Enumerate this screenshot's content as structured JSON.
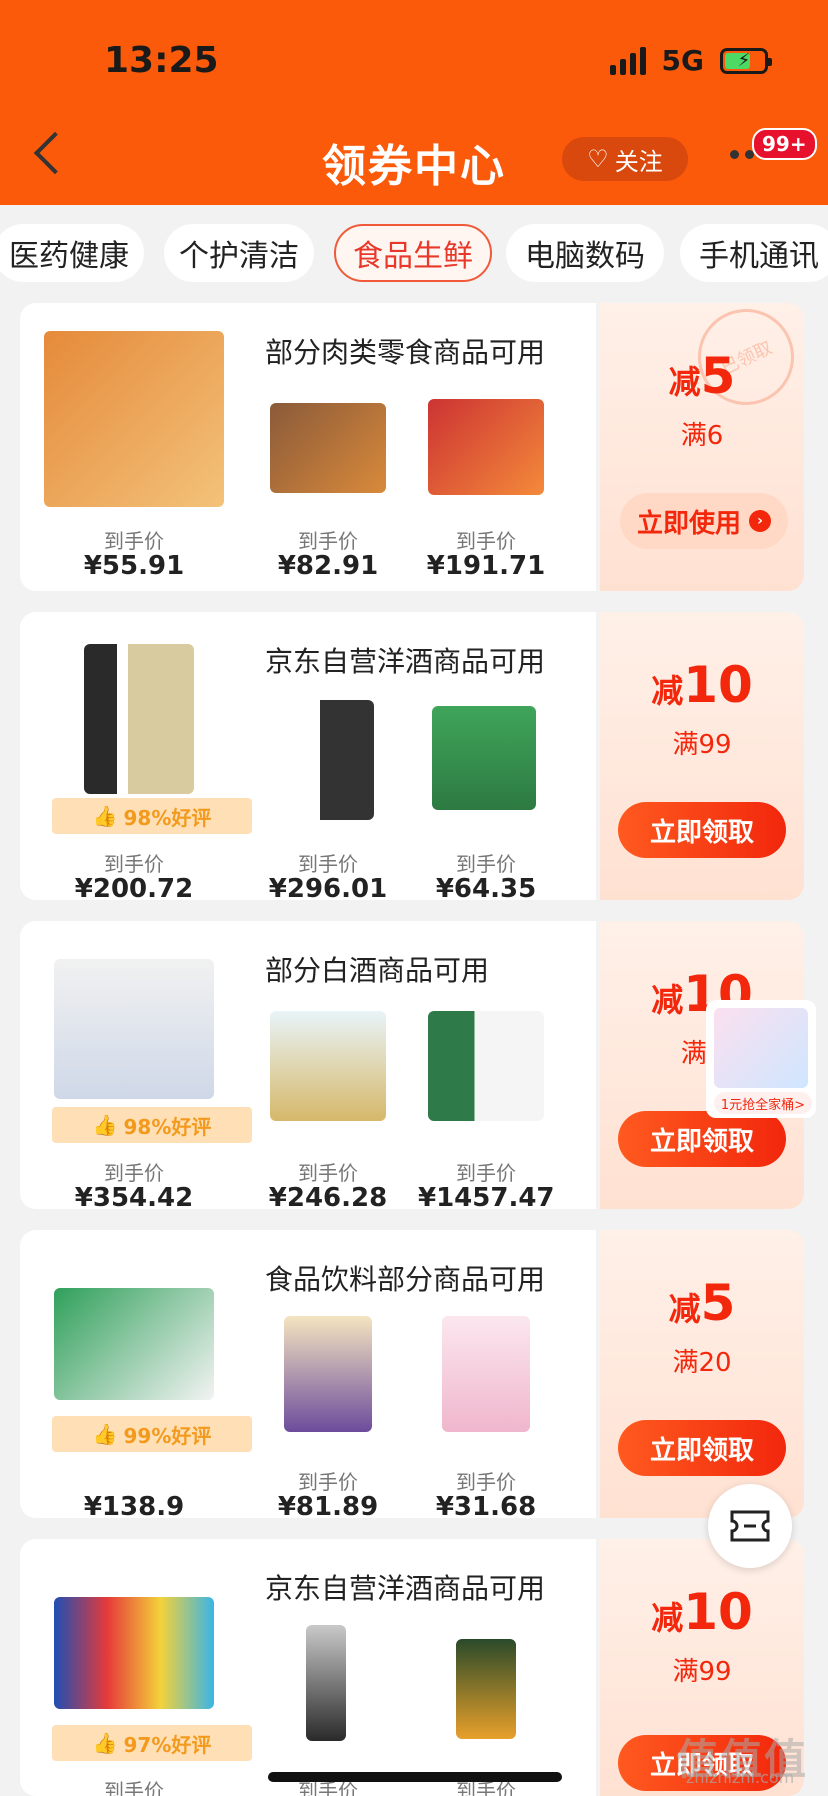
{
  "status": {
    "time": "13:25",
    "network": "5G"
  },
  "header": {
    "title": "领券中心",
    "follow_label": "关注",
    "badge": "99+"
  },
  "tabs": [
    "医药健康",
    "个护清洁",
    "食品生鲜",
    "电脑数码",
    "手机通讯"
  ],
  "active_tab": "食品生鲜",
  "coupons": [
    {
      "condition": "部分肉类零食商品可用",
      "products": [
        {
          "price_label": "到手价",
          "price": "¥55.91"
        },
        {
          "price_label": "到手价",
          "price": "¥82.91"
        },
        {
          "price_label": "到手价",
          "price": "¥191.71"
        }
      ],
      "discount_prefix": "减",
      "discount": "5",
      "threshold": "满6",
      "button": "立即使用",
      "stamp": "已领取"
    },
    {
      "condition": "京东自营洋酒商品可用",
      "rating": "98%好评",
      "products": [
        {
          "price_label": "到手价",
          "price": "¥200.72"
        },
        {
          "price_label": "到手价",
          "price": "¥296.01"
        },
        {
          "price_label": "到手价",
          "price": "¥64.35"
        }
      ],
      "discount_prefix": "减",
      "discount": "10",
      "threshold": "满99",
      "button": "立即领取"
    },
    {
      "condition": "部分白酒商品可用",
      "rating": "98%好评",
      "products": [
        {
          "price_label": "到手价",
          "price": "¥354.42"
        },
        {
          "price_label": "到手价",
          "price": "¥246.28"
        },
        {
          "price_label": "到手价",
          "price": "¥1457.47"
        }
      ],
      "discount_prefix": "减",
      "discount": "10",
      "threshold": "满1",
      "button": "立即领取"
    },
    {
      "condition": "食品饮料部分商品可用",
      "rating": "99%好评",
      "products": [
        {
          "price_label": "",
          "price": "¥138.9"
        },
        {
          "price_label": "到手价",
          "price": "¥81.89"
        },
        {
          "price_label": "到手价",
          "price": "¥31.68"
        }
      ],
      "discount_prefix": "减",
      "discount": "5",
      "threshold": "满20",
      "button": "立即领取"
    },
    {
      "condition": "京东自营洋酒商品可用",
      "rating": "97%好评",
      "products": [
        {
          "price_label": "到手价",
          "price": ""
        },
        {
          "price_label": "到手价",
          "price": ""
        },
        {
          "price_label": "到手价",
          "price": ""
        }
      ],
      "discount_prefix": "减",
      "discount": "10",
      "threshold": "满99",
      "button": "立即领取"
    }
  ],
  "float_ad": {
    "label": "1元抢全家桶>"
  },
  "watermark": {
    "main": "值值值",
    "sub": "zhizhizhi.com"
  },
  "colors": {
    "header": "#fa5a0a",
    "accent": "#f2270c",
    "rating_bg": "#ffe0b6",
    "rating_text": "#f39a1e"
  }
}
